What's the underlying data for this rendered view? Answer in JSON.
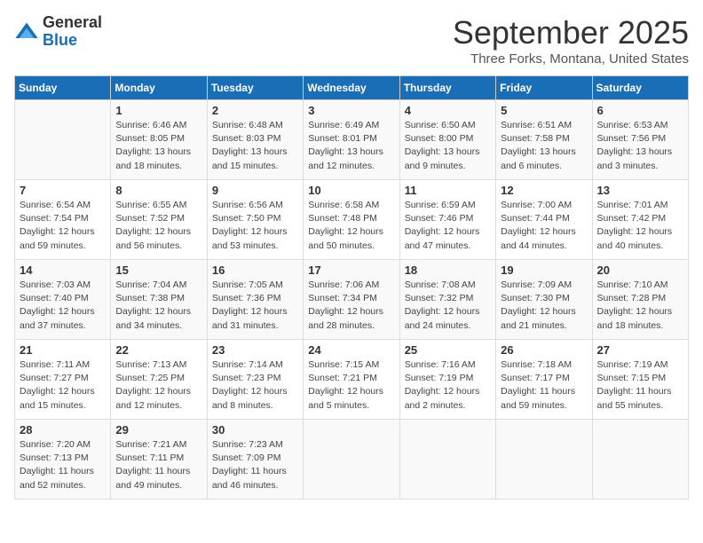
{
  "header": {
    "logo_line1": "General",
    "logo_line2": "Blue",
    "month_title": "September 2025",
    "subtitle": "Three Forks, Montana, United States"
  },
  "calendar": {
    "days_of_week": [
      "Sunday",
      "Monday",
      "Tuesday",
      "Wednesday",
      "Thursday",
      "Friday",
      "Saturday"
    ],
    "weeks": [
      [
        {
          "day": "",
          "info": ""
        },
        {
          "day": "1",
          "info": "Sunrise: 6:46 AM\nSunset: 8:05 PM\nDaylight: 13 hours\nand 18 minutes."
        },
        {
          "day": "2",
          "info": "Sunrise: 6:48 AM\nSunset: 8:03 PM\nDaylight: 13 hours\nand 15 minutes."
        },
        {
          "day": "3",
          "info": "Sunrise: 6:49 AM\nSunset: 8:01 PM\nDaylight: 13 hours\nand 12 minutes."
        },
        {
          "day": "4",
          "info": "Sunrise: 6:50 AM\nSunset: 8:00 PM\nDaylight: 13 hours\nand 9 minutes."
        },
        {
          "day": "5",
          "info": "Sunrise: 6:51 AM\nSunset: 7:58 PM\nDaylight: 13 hours\nand 6 minutes."
        },
        {
          "day": "6",
          "info": "Sunrise: 6:53 AM\nSunset: 7:56 PM\nDaylight: 13 hours\nand 3 minutes."
        }
      ],
      [
        {
          "day": "7",
          "info": "Sunrise: 6:54 AM\nSunset: 7:54 PM\nDaylight: 12 hours\nand 59 minutes."
        },
        {
          "day": "8",
          "info": "Sunrise: 6:55 AM\nSunset: 7:52 PM\nDaylight: 12 hours\nand 56 minutes."
        },
        {
          "day": "9",
          "info": "Sunrise: 6:56 AM\nSunset: 7:50 PM\nDaylight: 12 hours\nand 53 minutes."
        },
        {
          "day": "10",
          "info": "Sunrise: 6:58 AM\nSunset: 7:48 PM\nDaylight: 12 hours\nand 50 minutes."
        },
        {
          "day": "11",
          "info": "Sunrise: 6:59 AM\nSunset: 7:46 PM\nDaylight: 12 hours\nand 47 minutes."
        },
        {
          "day": "12",
          "info": "Sunrise: 7:00 AM\nSunset: 7:44 PM\nDaylight: 12 hours\nand 44 minutes."
        },
        {
          "day": "13",
          "info": "Sunrise: 7:01 AM\nSunset: 7:42 PM\nDaylight: 12 hours\nand 40 minutes."
        }
      ],
      [
        {
          "day": "14",
          "info": "Sunrise: 7:03 AM\nSunset: 7:40 PM\nDaylight: 12 hours\nand 37 minutes."
        },
        {
          "day": "15",
          "info": "Sunrise: 7:04 AM\nSunset: 7:38 PM\nDaylight: 12 hours\nand 34 minutes."
        },
        {
          "day": "16",
          "info": "Sunrise: 7:05 AM\nSunset: 7:36 PM\nDaylight: 12 hours\nand 31 minutes."
        },
        {
          "day": "17",
          "info": "Sunrise: 7:06 AM\nSunset: 7:34 PM\nDaylight: 12 hours\nand 28 minutes."
        },
        {
          "day": "18",
          "info": "Sunrise: 7:08 AM\nSunset: 7:32 PM\nDaylight: 12 hours\nand 24 minutes."
        },
        {
          "day": "19",
          "info": "Sunrise: 7:09 AM\nSunset: 7:30 PM\nDaylight: 12 hours\nand 21 minutes."
        },
        {
          "day": "20",
          "info": "Sunrise: 7:10 AM\nSunset: 7:28 PM\nDaylight: 12 hours\nand 18 minutes."
        }
      ],
      [
        {
          "day": "21",
          "info": "Sunrise: 7:11 AM\nSunset: 7:27 PM\nDaylight: 12 hours\nand 15 minutes."
        },
        {
          "day": "22",
          "info": "Sunrise: 7:13 AM\nSunset: 7:25 PM\nDaylight: 12 hours\nand 12 minutes."
        },
        {
          "day": "23",
          "info": "Sunrise: 7:14 AM\nSunset: 7:23 PM\nDaylight: 12 hours\nand 8 minutes."
        },
        {
          "day": "24",
          "info": "Sunrise: 7:15 AM\nSunset: 7:21 PM\nDaylight: 12 hours\nand 5 minutes."
        },
        {
          "day": "25",
          "info": "Sunrise: 7:16 AM\nSunset: 7:19 PM\nDaylight: 12 hours\nand 2 minutes."
        },
        {
          "day": "26",
          "info": "Sunrise: 7:18 AM\nSunset: 7:17 PM\nDaylight: 11 hours\nand 59 minutes."
        },
        {
          "day": "27",
          "info": "Sunrise: 7:19 AM\nSunset: 7:15 PM\nDaylight: 11 hours\nand 55 minutes."
        }
      ],
      [
        {
          "day": "28",
          "info": "Sunrise: 7:20 AM\nSunset: 7:13 PM\nDaylight: 11 hours\nand 52 minutes."
        },
        {
          "day": "29",
          "info": "Sunrise: 7:21 AM\nSunset: 7:11 PM\nDaylight: 11 hours\nand 49 minutes."
        },
        {
          "day": "30",
          "info": "Sunrise: 7:23 AM\nSunset: 7:09 PM\nDaylight: 11 hours\nand 46 minutes."
        },
        {
          "day": "",
          "info": ""
        },
        {
          "day": "",
          "info": ""
        },
        {
          "day": "",
          "info": ""
        },
        {
          "day": "",
          "info": ""
        }
      ]
    ]
  }
}
